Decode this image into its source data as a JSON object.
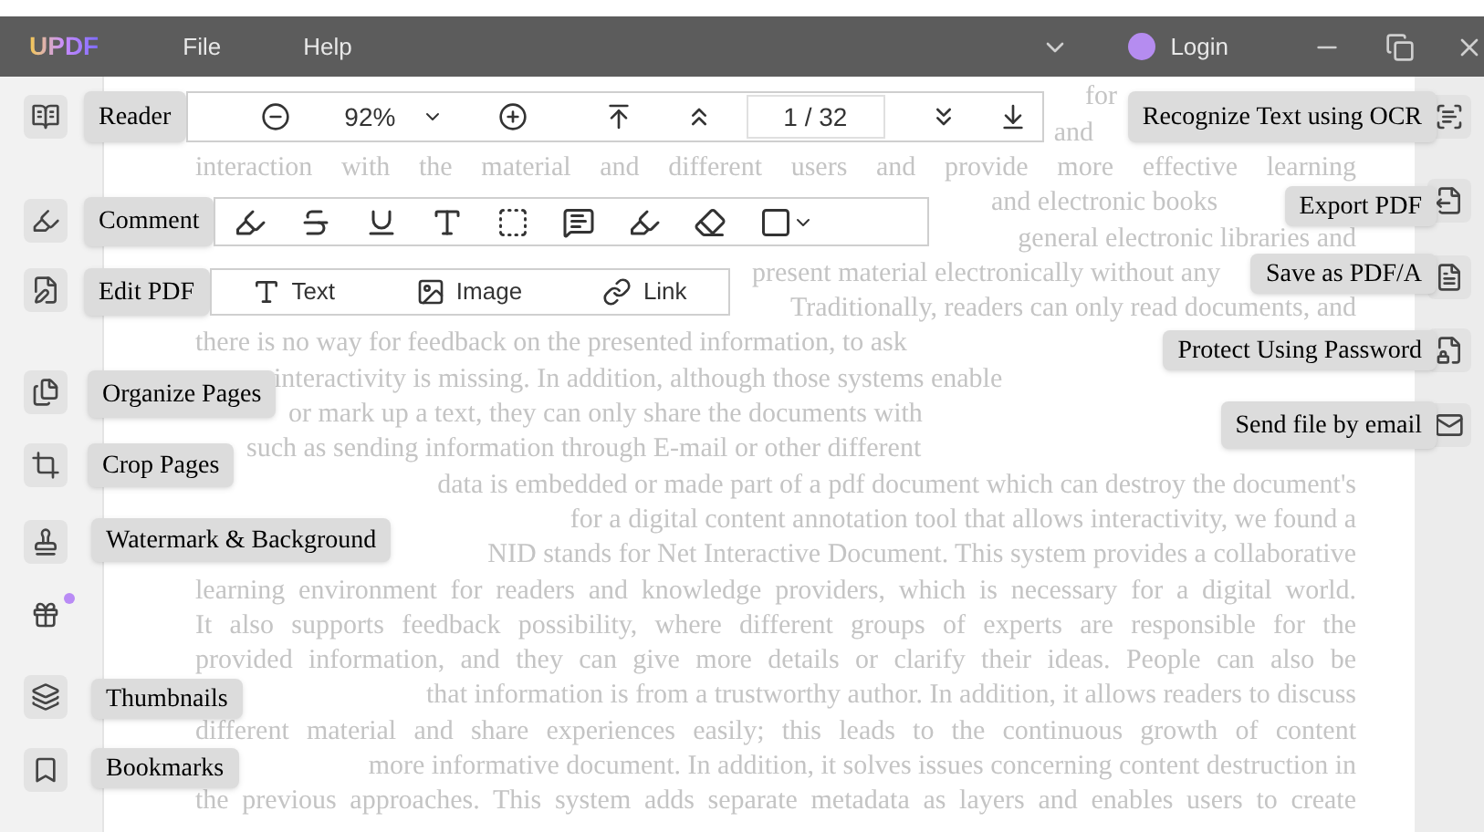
{
  "title_bar": {
    "logo": "UPDF",
    "menus": [
      "File",
      "Help"
    ],
    "account": "Login"
  },
  "sidebar": {
    "items": [
      {
        "kind": "tool",
        "tooltip": "Reader"
      },
      {
        "kind": "tool",
        "tooltip": "Comment"
      },
      {
        "kind": "tool",
        "tooltip": "Edit PDF"
      },
      {
        "kind": "tool",
        "tooltip": "Organize Pages"
      },
      {
        "kind": "tool",
        "tooltip": "Crop Pages"
      },
      {
        "kind": "tool",
        "tooltip": "Watermark & Background"
      },
      {
        "kind": "promo",
        "notification": true
      },
      {
        "kind": "tool",
        "tooltip": "Thumbnails"
      },
      {
        "kind": "tool",
        "tooltip": "Bookmarks"
      }
    ]
  },
  "reader_toolbar": {
    "zoom": "92%",
    "page_field": "1 / 32"
  },
  "edit_toolbar": {
    "tools": [
      "Text",
      "Image",
      "Link"
    ]
  },
  "right_panel": {
    "items": [
      {
        "tooltip": "Recognize Text using OCR"
      },
      {
        "tooltip": "Export PDF"
      },
      {
        "tooltip": "Save as PDF/A"
      },
      {
        "tooltip": "Protect Using Password"
      },
      {
        "tooltip": "Send file by email"
      }
    ]
  },
  "document": {
    "lines": [
      {
        "parts": [
          "for"
        ]
      },
      {
        "parts": [
          "and"
        ]
      },
      {
        "parts": [
          "interaction with the material and different users and provide more effective learning"
        ]
      },
      {
        "parts": [
          "and electronic books"
        ]
      },
      {
        "parts": [
          "general electronic libraries and"
        ]
      },
      {
        "parts": [
          "present material electronically without any"
        ]
      },
      {
        "parts": [
          "Traditionally, readers can only read documents, and"
        ]
      },
      {
        "parts": [
          "there is no way for feedback on the presented information, to ask"
        ]
      },
      {
        "parts": [
          "interactivity is missing. In addition, although those systems enable"
        ]
      },
      {
        "parts": [
          "or mark up a text, they can only share the documents with"
        ]
      },
      {
        "parts": [
          "such as sending information through E-mail or other different"
        ]
      },
      {
        "parts": [
          "data is embedded or made part of a pdf document which can destroy the document's"
        ]
      },
      {
        "parts": [
          "for a digital content annotation tool that allows interactivity, we found a"
        ]
      },
      {
        "parts": [
          "NID stands for Net Interactive Document. This system provides a collaborative"
        ]
      },
      {
        "parts": [
          "learning environment for readers and knowledge providers, which is necessary for a digital world."
        ]
      },
      {
        "parts": [
          "It also supports feedback possibility, where different groups of experts are responsible for the"
        ]
      },
      {
        "parts": [
          "provided information, and they can give more details or clarify their ideas. People can also be"
        ]
      },
      {
        "parts": [
          "that information is from a trustworthy author. In addition, it allows readers to discuss"
        ]
      },
      {
        "parts": [
          "different material and share experiences easily; this leads to the continuous growth of content"
        ]
      },
      {
        "parts": [
          "more informative document. In addition, it solves issues concerning content destruction in"
        ]
      },
      {
        "parts": [
          "the previous approaches. This system adds separate metadata as layers and enables users to create"
        ]
      }
    ]
  }
}
